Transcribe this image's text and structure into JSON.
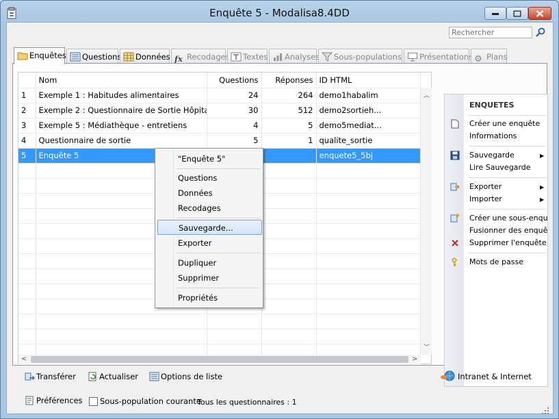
{
  "window": {
    "title": "Enquête 5 - Modalisa8.4DD"
  },
  "search": {
    "placeholder": "Rechercher"
  },
  "tabs": [
    {
      "label": "Enquêtes",
      "icon": "folder-icon",
      "active": true
    },
    {
      "label": "Questions",
      "icon": "list-icon"
    },
    {
      "label": "Données",
      "icon": "table-icon"
    },
    {
      "label": "Recodages",
      "icon": "fx-icon"
    },
    {
      "label": "Textes",
      "icon": "text-icon"
    },
    {
      "label": "Analyses",
      "icon": "chart-icon"
    },
    {
      "label": "Sous-populations",
      "icon": "filter-icon"
    },
    {
      "label": "Présentations",
      "icon": "presentation-icon"
    },
    {
      "label": "Plans",
      "icon": "gear-icon"
    }
  ],
  "grid": {
    "columns": [
      "Nom",
      "Questions",
      "Réponses",
      "ID HTML"
    ],
    "rows": [
      {
        "n": "1",
        "nom": "Exemple 1 : Habitudes alimentaires",
        "questions": "24",
        "reponses": "264",
        "id": "demo1habalim"
      },
      {
        "n": "2",
        "nom": "Exemple 2 : Questionnaire de Sortie  Hôpital",
        "questions": "30",
        "reponses": "512",
        "id": "demo2sortieh..."
      },
      {
        "n": "3",
        "nom": "Exemple 5 : Médiathèque - entretiens",
        "questions": "4",
        "reponses": "5",
        "id": "demo5mediat..."
      },
      {
        "n": "4",
        "nom": "Questionnaire de sortie",
        "questions": "5",
        "reponses": "1",
        "id": "qualite_sortie"
      },
      {
        "n": "5",
        "nom": "Enquête 5",
        "questions": "",
        "reponses": "",
        "id": "enquete5_5bj",
        "selected": true
      }
    ]
  },
  "sidebar": {
    "header": "ENQUETES",
    "items": {
      "create": "Créer une enquête",
      "info": "Informations",
      "save": "Sauvegarde",
      "read_save": "Lire Sauvegarde",
      "export": "Exporter",
      "import": "Importer",
      "create_subpop": "Créer une sous-enquête",
      "merge": "Fusionner des enquêtes",
      "delete": "Supprimer l'enquête",
      "passwords": "Mots de passe"
    }
  },
  "context_menu": {
    "title": "\"Enquête 5\"",
    "items": [
      "Questions",
      "Données",
      "Recodages"
    ],
    "save": "Sauvegarde...",
    "export": "Exporter",
    "duplicate": "Dupliquer",
    "delete": "Supprimer",
    "properties": "Propriétés"
  },
  "bottom": {
    "transfer": "Transférer",
    "refresh": "Actualiser",
    "list_options": "Options de liste",
    "intranet": "Intranet & Internet"
  },
  "status": {
    "preferences": "Préférences",
    "subpop_label": "Sous-population courante",
    "count_text": "Tous les questionnaires : 1"
  },
  "colors": {
    "selection": "#3399ff",
    "close_button": "#c7462e"
  }
}
